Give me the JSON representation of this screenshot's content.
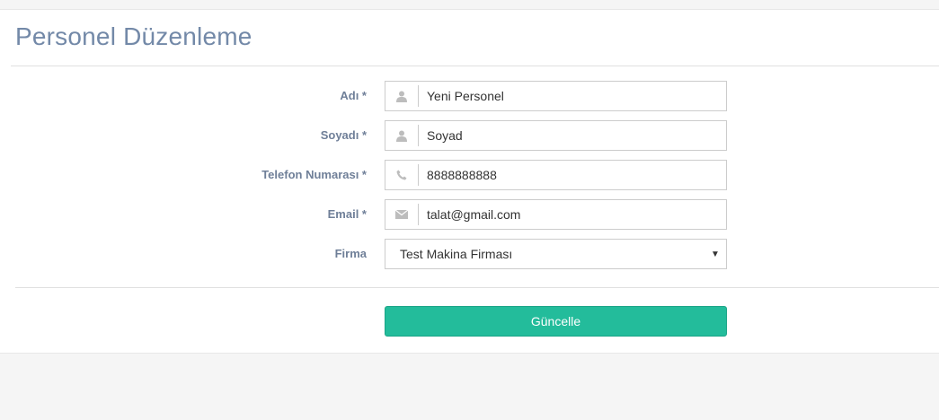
{
  "page": {
    "title": "Personel Düzenleme"
  },
  "form": {
    "fields": [
      {
        "label": "Adı *",
        "value": "Yeni Personel",
        "icon": "user-icon"
      },
      {
        "label": "Soyadı *",
        "value": "Soyad",
        "icon": "user-icon"
      },
      {
        "label": "Telefon Numarası *",
        "value": "8888888888",
        "icon": "phone-icon"
      },
      {
        "label": "Email *",
        "value": "talat@gmail.com",
        "icon": "envelope-icon"
      }
    ],
    "firma": {
      "label": "Firma",
      "selected": "Test Makina Firması"
    },
    "submit_label": "Güncelle"
  },
  "colors": {
    "title": "#7389a8",
    "label": "#6f7f98",
    "button": "#23bc9b",
    "icon": "#bdbdbd"
  }
}
